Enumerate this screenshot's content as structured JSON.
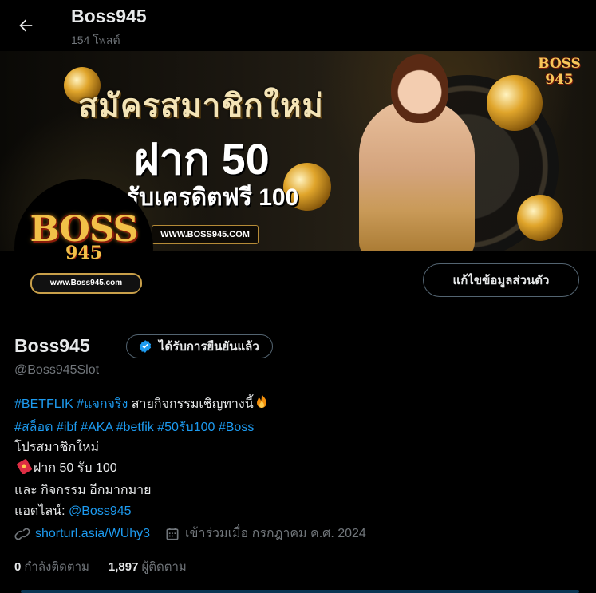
{
  "header": {
    "title": "Boss945",
    "post_count": "154 โพสต์"
  },
  "banner": {
    "line1": "สมัครสมาชิกใหม่",
    "line2": "ฝาก 50",
    "line3": "รับเครดิตฟรี 100",
    "url": "WWW.BOSS945.COM",
    "logo_text": "BOSS 945"
  },
  "avatar": {
    "logo_text": "BOSS",
    "logo_number": "945",
    "url": "www.Boss945.com"
  },
  "profile": {
    "edit_button": "แก้ไขข้อมูลส่วนตัว",
    "name": "Boss945",
    "verified_label": "ได้รับการยืนยันแล้ว",
    "handle": "@Boss945Slot"
  },
  "bio": {
    "line1_tags": [
      "#BETFLIK",
      "#แจกจริง"
    ],
    "line1_text": "สายกิจกรรมเชิญทางนี้",
    "line2_tags": [
      "#สล็อต",
      "#ibf",
      "#AKA",
      "#betfik",
      "#50รับ100",
      "#Boss"
    ],
    "line3": "โปรสมาชิกใหม่",
    "line4": "ฝาก 50 รับ 100",
    "line5": "และ กิจกรรม อีกมากมาย",
    "line6_label": "แอดไลน์:",
    "line6_mention": "@Boss945"
  },
  "meta": {
    "link": "shorturl.asia/WUhy3",
    "joined": "เข้าร่วมเมื่อ กรกฎาคม ค.ศ. 2024"
  },
  "stats": {
    "following_count": "0",
    "following_label": "กำลังติดตาม",
    "followers_count": "1,897",
    "followers_label": "ผู้ติดตาม"
  },
  "colors": {
    "accent": "#1d9bf0",
    "background": "#000000",
    "secondary_text": "#71767b"
  }
}
